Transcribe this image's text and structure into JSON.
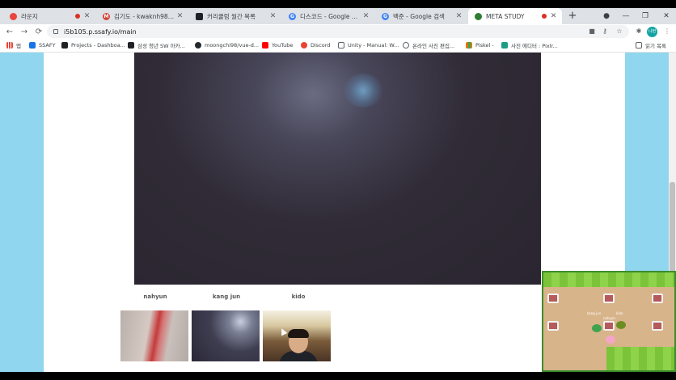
{
  "tabs": [
    {
      "title": "라운지",
      "recording": true,
      "icon_color": "#e8453c",
      "active": false
    },
    {
      "title": "김기도 - kwaknh98@gmail...",
      "recording": false,
      "icon_color": "#d44638",
      "active": false
    },
    {
      "title": "커리큘럼 월간 목록",
      "recording": false,
      "icon_color": "#202124",
      "active": false
    },
    {
      "title": "디스코드 - Google 검색",
      "recording": false,
      "icon_color": "#4285f4",
      "active": false
    },
    {
      "title": "백준 - Google 검색",
      "recording": false,
      "icon_color": "#4285f4",
      "active": false
    },
    {
      "title": "META STUDY",
      "recording": true,
      "icon_color": "#2e7d32",
      "active": true
    }
  ],
  "window_controls": {
    "new_tab": "+",
    "minimize": "—",
    "maximize": "❐",
    "close": "✕",
    "tab_close": "✕"
  },
  "toolbar": {
    "back": "←",
    "forward": "→",
    "reload": "⟳",
    "url": "i5b105.p.ssafy.io/main",
    "profile_initials": "나현"
  },
  "bookmarks": [
    {
      "label": "앱",
      "icon_color": "#ea4335"
    },
    {
      "label": "SSAFY",
      "icon_color": "#1a73e8"
    },
    {
      "label": "Projects - Dashboa...",
      "icon_color": "#202124"
    },
    {
      "label": "삼성 청년 SW 아카...",
      "icon_color": "#202124"
    },
    {
      "label": "moongchi98/vue-d...",
      "icon_color": "#24292e"
    },
    {
      "label": "YouTube",
      "icon_color": "#ff0000"
    },
    {
      "label": "Discord",
      "icon_color": "#ea4335"
    },
    {
      "label": "Unity - Manual: W...",
      "icon_color": "#5f6368"
    },
    {
      "label": "온라인 사진 편집...",
      "icon_color": "#5f6368"
    },
    {
      "label": "Piskel -",
      "icon_color": "#e37400"
    },
    {
      "label": "사진 에디터 : Pixlr...",
      "icon_color": "#1b9c85"
    }
  ],
  "reading_list": "읽기 목록",
  "participants": [
    {
      "name": "nahyun"
    },
    {
      "name": "kang jun"
    },
    {
      "name": "kido"
    }
  ],
  "minimap": {
    "labels": [
      "kang jun",
      "kido",
      "nahyun"
    ]
  },
  "colors": {
    "page_background": "#8fd6ee",
    "tabbar": "#dee1e6",
    "minimap_grass": "#7bc43a",
    "minimap_floor": "#d8b48a"
  }
}
